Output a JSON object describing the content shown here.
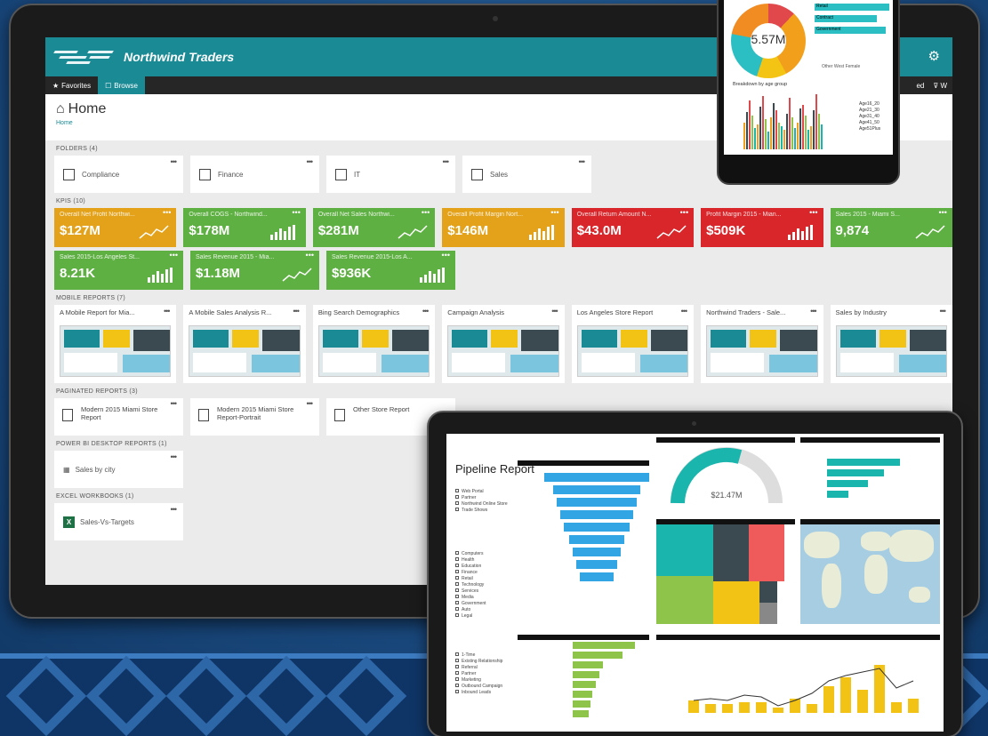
{
  "app": {
    "brand": "Northwind Traders",
    "nav": {
      "favorites": "Favorites",
      "browse": "Browse",
      "right1": "ed",
      "right2": "W"
    },
    "home_title": "Home",
    "home_sub": "Home"
  },
  "sections": {
    "folders": "FOLDERS (4)",
    "kpis": "KPIS (10)",
    "mobile": "MOBILE REPORTS (7)",
    "paginated": "PAGINATED REPORTS (3)",
    "pbi": "POWER BI DESKTOP REPORTS (1)",
    "excel": "EXCEL WORKBOOKS (1)"
  },
  "folders": [
    {
      "label": "Compliance"
    },
    {
      "label": "Finance"
    },
    {
      "label": "IT"
    },
    {
      "label": "Sales"
    }
  ],
  "kpis": [
    {
      "title": "Overall Net Profit Northwi...",
      "value": "$127M",
      "color": "#e3a21a"
    },
    {
      "title": "Overall COGS - Northwind...",
      "value": "$178M",
      "color": "#5fb043"
    },
    {
      "title": "Overall Net Sales Northwi...",
      "value": "$281M",
      "color": "#5fb043"
    },
    {
      "title": "Overall Profit Margin Nort...",
      "value": "$146M",
      "color": "#e3a21a"
    },
    {
      "title": "Overall Return Amount N...",
      "value": "$43.0M",
      "color": "#d9262b"
    },
    {
      "title": "Profit Margin 2015 - Mian...",
      "value": "$509K",
      "color": "#d9262b"
    },
    {
      "title": "Sales 2015 - Miami S...",
      "value": "9,874",
      "color": "#5fb043"
    },
    {
      "title": "Sales 2015-Los Angeles St...",
      "value": "8.21K",
      "color": "#5fb043"
    },
    {
      "title": "Sales Revenue 2015 - Mia...",
      "value": "$1.18M",
      "color": "#5fb043"
    },
    {
      "title": "Sales Revenue 2015-Los A...",
      "value": "$936K",
      "color": "#5fb043"
    }
  ],
  "mobile_reports": [
    {
      "title": "A Mobile Report for Mia..."
    },
    {
      "title": "A Mobile Sales Analysis R..."
    },
    {
      "title": "Bing Search Demographics"
    },
    {
      "title": "Campaign Analysis"
    },
    {
      "title": "Los Angeles Store Report"
    },
    {
      "title": "Northwind Traders - Sale..."
    },
    {
      "title": "Sales by Industry"
    }
  ],
  "paginated_reports": [
    {
      "title": "Modern 2015 Miami Store Report"
    },
    {
      "title": "Modern 2015 Miami Store Report-Portrait"
    },
    {
      "title": "Other Store Report"
    }
  ],
  "pbi_reports": [
    {
      "title": "Sales by city"
    }
  ],
  "excel_workbooks": [
    {
      "title": "Sales-Vs-Targets"
    }
  ],
  "phone": {
    "donut_value": "5.57M",
    "bar_labels": [
      "Retail",
      "Contract",
      "Government"
    ],
    "legend": "Other  West  Female",
    "age_title": "Breakdown by age group",
    "age_legend": [
      "Age16_20",
      "Age21_30",
      "Age31_40",
      "Age41_50",
      "Age51Plus"
    ]
  },
  "tablet": {
    "title": "Pipeline Report",
    "gauge_value": "$21.47M",
    "slicer1": [
      "Web Portal",
      "Partner",
      "Northwind Online Store",
      "Trade Shows"
    ],
    "slicer2": [
      "Computers",
      "Health",
      "Education",
      "Finance",
      "Retail",
      "Technology",
      "Services",
      "Media",
      "Government",
      "Auto",
      "Legal"
    ],
    "slicer3": [
      "1-Time",
      "Existing Relationship",
      "Referral",
      "Partner",
      "Marketing",
      "Outbound Campaign",
      "Inbound Leads"
    ]
  }
}
